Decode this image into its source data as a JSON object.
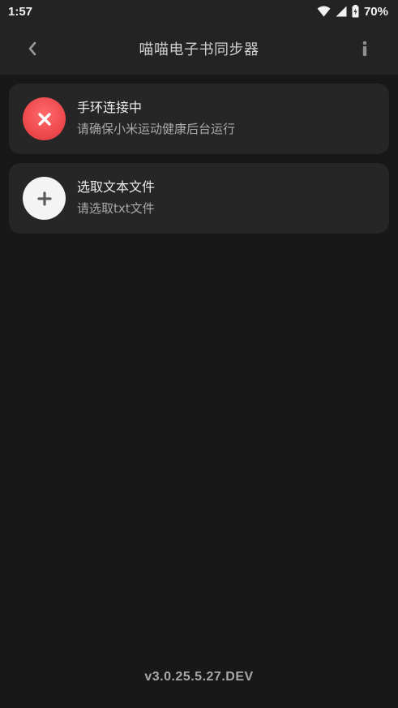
{
  "status_bar": {
    "time": "1:57",
    "battery": "70%"
  },
  "app_bar": {
    "title": "喵喵电子书同步器",
    "back_icon": "chevron-left-icon",
    "info_icon": "info-icon"
  },
  "cards": [
    {
      "title": "手环连接中",
      "subtitle": "请确保小米运动健康后台运行",
      "icon": "close-icon",
      "icon_bg": "#ee4a4e"
    },
    {
      "title": "选取文本文件",
      "subtitle": "请选取txt文件",
      "icon": "plus-icon",
      "icon_bg": "#f4f4f4"
    }
  ],
  "footer": {
    "version": "v3.0.25.5.27.DEV"
  }
}
